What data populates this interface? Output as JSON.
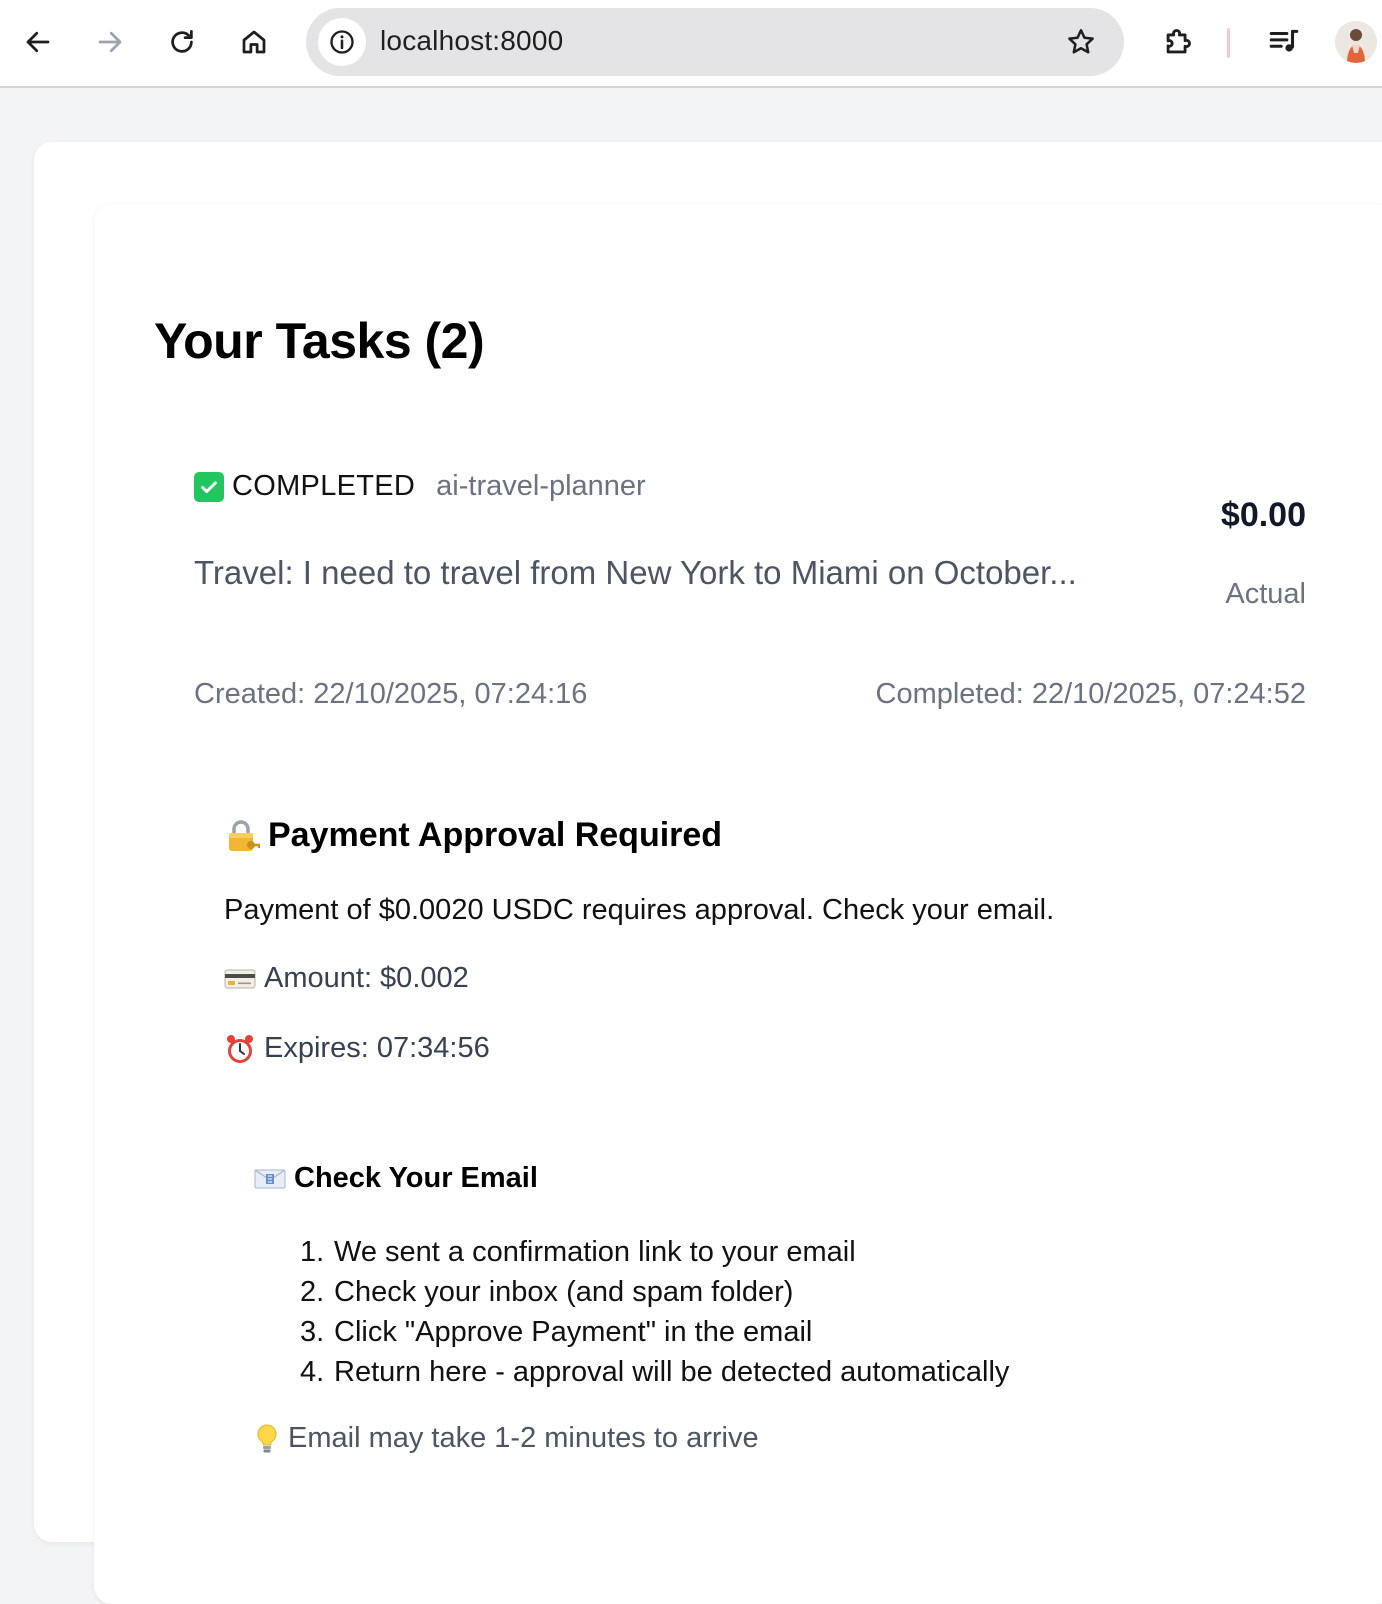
{
  "browser": {
    "url": "localhost:8000",
    "icons": {
      "back": "arrow-left-icon",
      "forward": "arrow-right-icon",
      "reload": "reload-icon",
      "home": "home-icon",
      "site_info": "info-icon",
      "bookmark": "star-icon",
      "extensions": "puzzle-icon",
      "media": "media-control-icon",
      "profile": "avatar"
    }
  },
  "page": {
    "title": "Your Tasks (2)"
  },
  "task": {
    "status_icon": "white-check-mark-icon",
    "status": "COMPLETED",
    "agent": "ai-travel-planner",
    "price": "$0.00",
    "price_label": "Actual",
    "description": "Travel: I need to travel from New York to Miami on October...",
    "created": "Created: 22/10/2025, 07:24:16",
    "completed": "Completed: 22/10/2025, 07:24:52"
  },
  "approval": {
    "icon": "locked-with-key-icon",
    "title": "Payment Approval Required",
    "message": "Payment of $0.0020 USDC requires approval. Check your email.",
    "amount_icon": "credit-card-icon",
    "amount": "Amount: $0.002",
    "expires_icon": "alarm-clock-icon",
    "expires": "Expires: 07:34:56",
    "email": {
      "icon": "incoming-envelope-icon",
      "title": "Check Your Email",
      "steps": [
        {
          "num": "1.",
          "text": "We sent a confirmation link to your email"
        },
        {
          "num": "2.",
          "text": "Check your inbox (and spam folder)"
        },
        {
          "num": "3.",
          "text": "Click \"Approve Payment\" in the email"
        },
        {
          "num": "4.",
          "text": "Return here - approval will be detected automatically"
        }
      ],
      "tip_icon": "light-bulb-icon",
      "tip": "Email may take 1-2 minutes to arrive"
    }
  },
  "colors": {
    "page_bg": "#f3f4f6",
    "card_bg": "#ffffff",
    "muted_text": "#6b7280",
    "status_green": "#22c55e"
  }
}
